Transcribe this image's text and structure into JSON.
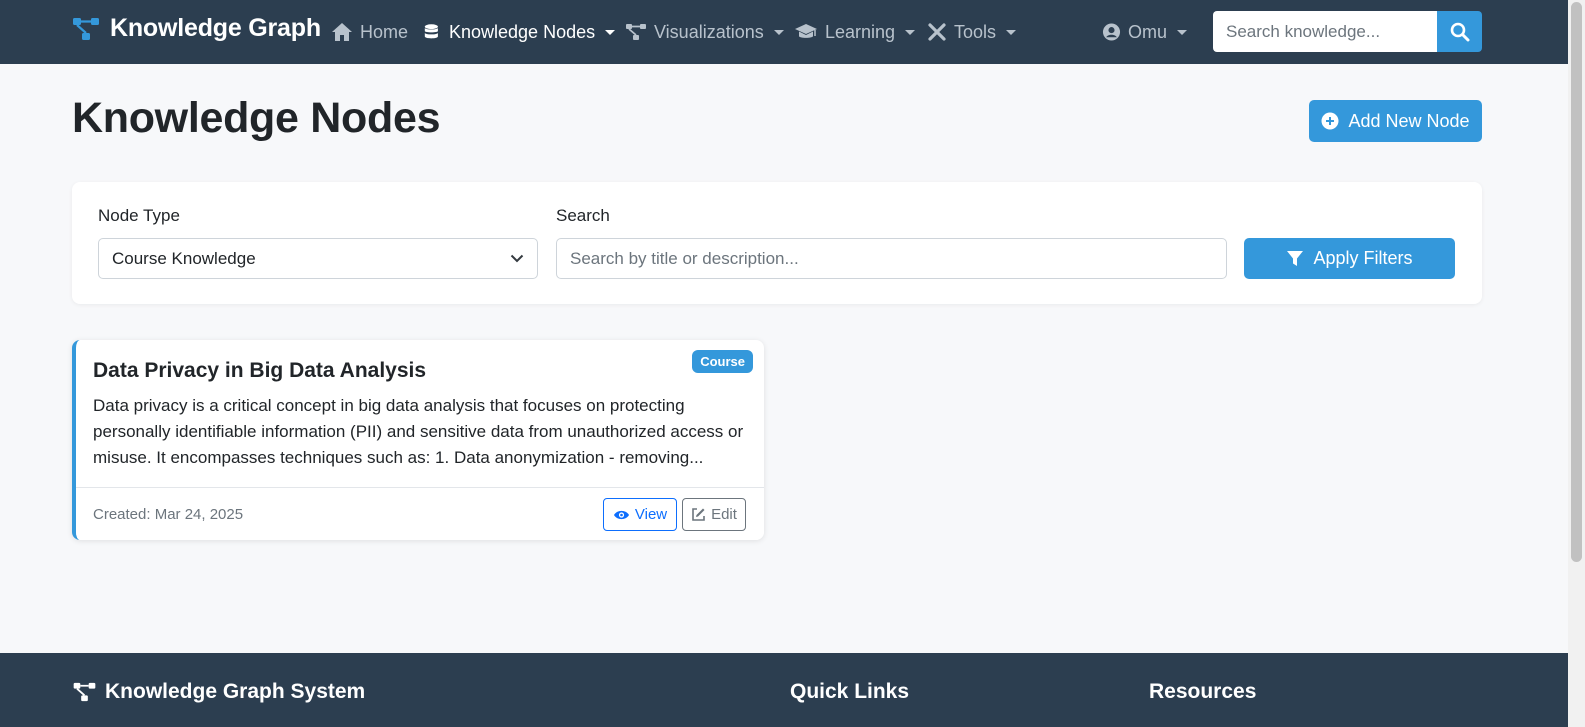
{
  "colors": {
    "navbar_bg": "#2c3e50",
    "accent": "#3498db",
    "page_bg": "#f7f8fa"
  },
  "navbar": {
    "brand": "Knowledge Graph",
    "items": [
      {
        "label": "Home",
        "icon": "home-icon"
      },
      {
        "label": "Knowledge Nodes",
        "icon": "database-icon",
        "active": true,
        "dropdown": true
      },
      {
        "label": "Visualizations",
        "icon": "diagram-icon",
        "dropdown": true
      },
      {
        "label": "Learning",
        "icon": "graduation-cap-icon",
        "dropdown": true
      },
      {
        "label": "Tools",
        "icon": "tools-icon",
        "dropdown": true
      }
    ],
    "user": {
      "label": "Omu",
      "icon": "user-circle-icon"
    },
    "search": {
      "placeholder": "Search knowledge..."
    }
  },
  "page": {
    "title": "Knowledge Nodes",
    "add_button": "Add New Node"
  },
  "filters": {
    "node_type_label": "Node Type",
    "node_type_value": "Course Knowledge",
    "search_label": "Search",
    "search_placeholder": "Search by title or description...",
    "apply_button": "Apply Filters"
  },
  "nodes": [
    {
      "badge": "Course",
      "title": "Data Privacy in Big Data Analysis",
      "description": "Data privacy is a critical concept in big data analysis that focuses on protecting personally identifiable information (PII) and sensitive data from unauthorized access or misuse. It encompasses techniques such as: 1. Data anonymization - removing...",
      "created": "Created: Mar 24, 2025",
      "view_label": "View",
      "edit_label": "Edit"
    }
  ],
  "footer": {
    "brand": "Knowledge Graph System",
    "quick_links": "Quick Links",
    "resources": "Resources"
  }
}
